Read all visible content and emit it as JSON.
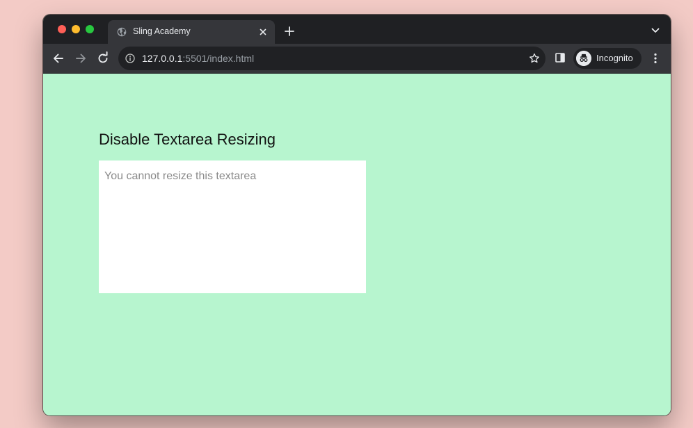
{
  "browser": {
    "tab": {
      "title": "Sling Academy",
      "favicon": "globe-icon"
    },
    "address_bar": {
      "host": "127.0.0.1",
      "rest": ":5501/index.html"
    },
    "profile": {
      "label": "Incognito",
      "icon": "incognito-icon"
    },
    "colors": {
      "tab_strip": "#1f2023",
      "toolbar": "#35363a",
      "omnibox": "#202124"
    }
  },
  "page": {
    "heading": "Disable Textarea Resizing",
    "textarea": {
      "placeholder": "You cannot resize this textarea",
      "value": ""
    },
    "colors": {
      "background": "#b7f5cf",
      "desktop": "#f3cbc6"
    }
  }
}
